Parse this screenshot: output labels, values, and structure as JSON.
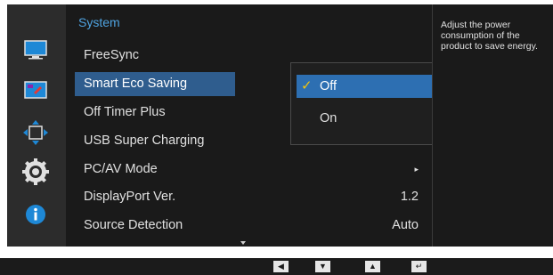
{
  "menu": {
    "title": "System",
    "items": [
      {
        "label": "FreeSync",
        "value": ""
      },
      {
        "label": "Smart Eco Saving",
        "value": ""
      },
      {
        "label": "Off Timer Plus",
        "value": ""
      },
      {
        "label": "USB Super Charging",
        "value": ""
      },
      {
        "label": "PC/AV Mode",
        "value": "▸"
      },
      {
        "label": "DisplayPort Ver.",
        "value": "1.2"
      },
      {
        "label": "Source Detection",
        "value": "Auto"
      }
    ]
  },
  "submenu": {
    "options": [
      {
        "label": "Off",
        "checked": true
      },
      {
        "label": "On",
        "checked": false
      }
    ],
    "check_glyph": "✓"
  },
  "help": {
    "text": "Adjust the power\nconsumption of the\nproduct to save energy."
  },
  "icons": [
    "picture-icon",
    "color-icon",
    "screen-size-icon",
    "system-gear-icon",
    "information-icon"
  ],
  "nav": {
    "left": "◀",
    "down": "▼",
    "up": "▲",
    "enter": "↵"
  },
  "colors": {
    "accent": "#4fa3e0",
    "selection": "#2f5d8e",
    "submenu_selection": "#2d6fb2",
    "check": "#f1c40f"
  }
}
